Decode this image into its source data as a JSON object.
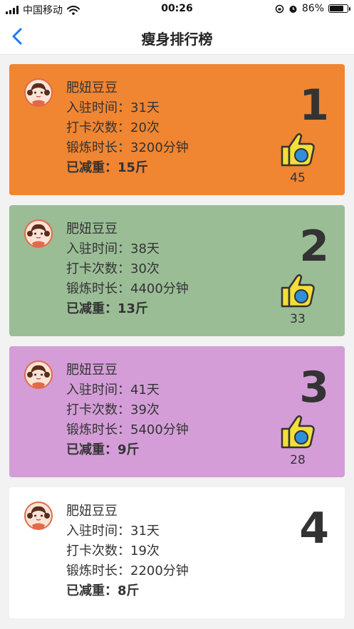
{
  "status": {
    "carrier": "中国移动",
    "time": "00:26",
    "battery_text": "86%",
    "battery_level": 0.86
  },
  "nav": {
    "title": "瘦身排行榜"
  },
  "colors": {
    "card1": "#f08532",
    "card2": "#9abd96",
    "card3": "#d49dd8",
    "card4": "#ffffff"
  },
  "cards": [
    {
      "name": "肥妞豆豆",
      "joined": "入驻时间：31天",
      "checkins": "打卡次数：20次",
      "duration": "锻炼时长：3200分钟",
      "lost": "已减重：15斤",
      "rank": "1",
      "likes": "45"
    },
    {
      "name": "肥妞豆豆",
      "joined": "入驻时间：38天",
      "checkins": "打卡次数：30次",
      "duration": "锻炼时长：4400分钟",
      "lost": "已减重：13斤",
      "rank": "2",
      "likes": "33"
    },
    {
      "name": "肥妞豆豆",
      "joined": "入驻时间：41天",
      "checkins": "打卡次数：39次",
      "duration": "锻炼时长：5400分钟",
      "lost": "已减重：9斤",
      "rank": "3",
      "likes": "28"
    },
    {
      "name": "肥妞豆豆",
      "joined": "入驻时间：31天",
      "checkins": "打卡次数：19次",
      "duration": "锻炼时长：2200分钟",
      "lost": "已减重：8斤",
      "rank": "4"
    }
  ]
}
